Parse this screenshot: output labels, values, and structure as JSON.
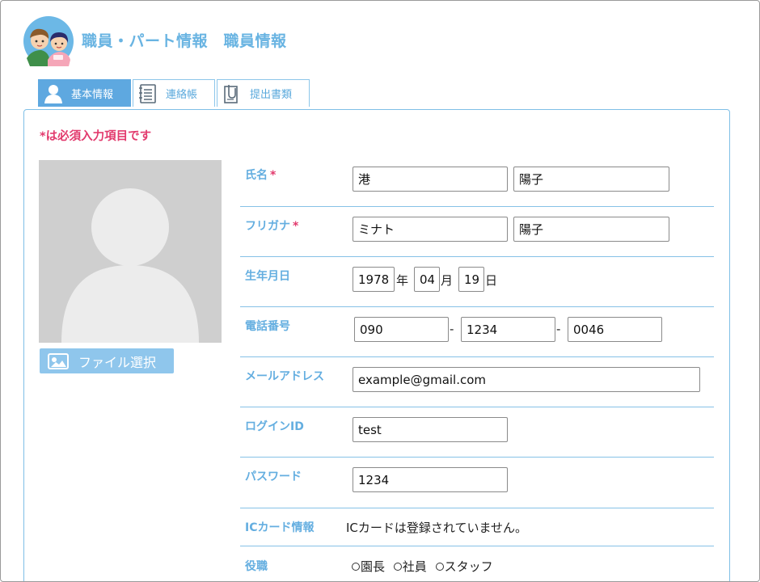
{
  "header": {
    "title": "職員・パート情報　職員情報"
  },
  "tabs": [
    {
      "label": "基本情報",
      "icon": "person-icon",
      "active": true
    },
    {
      "label": "連絡帳",
      "icon": "notebook-icon",
      "active": false
    },
    {
      "label": "提出書類",
      "icon": "document-clip-icon",
      "active": false
    }
  ],
  "form": {
    "required_note": "*は必須入力項目です",
    "required_mark": "*",
    "file_button": "ファイル選択",
    "name": {
      "label": "氏名",
      "last": "港",
      "first": "陽子"
    },
    "kana": {
      "label": "フリガナ",
      "last": "ミナト",
      "first": "陽子"
    },
    "birth": {
      "label": "生年月日",
      "year": "1978",
      "year_unit": "年",
      "month": "04",
      "month_unit": "月",
      "day": "19",
      "day_unit": "日"
    },
    "phone": {
      "label": "電話番号",
      "part1": "090",
      "part2": "1234",
      "part3": "0046",
      "dash": "-"
    },
    "email": {
      "label": "メールアドレス",
      "value": "example@gmail.com"
    },
    "login": {
      "label": "ログインID",
      "value": "test"
    },
    "password": {
      "label": "パスワード",
      "value": "1234"
    },
    "ic_card": {
      "label": "ICカード情報",
      "status": "ICカードは登録されていません。"
    },
    "role": {
      "label": "役職",
      "options": [
        "園長",
        "社員",
        "スタッフ"
      ]
    }
  },
  "colors": {
    "accent": "#5ea8e0",
    "label": "#64aee0",
    "required": "#e23a6d",
    "avatar_bg": "#cfcfcf"
  }
}
